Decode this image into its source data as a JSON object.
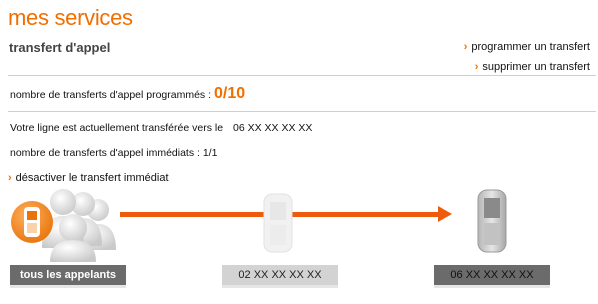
{
  "header": {
    "title": "mes services",
    "subtitle": "transfert d'appel"
  },
  "actions": {
    "schedule_label": "programmer un transfert",
    "delete_label": "supprimer un transfert"
  },
  "scheduled": {
    "label": "nombre de transferts d'appel programmés :",
    "count": "0/10"
  },
  "current": {
    "label": "Votre ligne est actuellement transférée vers le",
    "number": "06 XX XX XX XX",
    "immediate_label": "nombre de transferts d'appel immédiats : 1/1",
    "deactivate_label": "désactiver le transfert immédiat"
  },
  "diagram": {
    "source_label": "tous les appelants",
    "origin_number": "02  XX XX XX XX",
    "destination_number": "06 XX XX XX XX",
    "accent_color": "#ef5b0c"
  },
  "icons": {
    "chevron": "chevron-right-icon",
    "group": "user-group-icon",
    "phone": "mobile-phone-icon"
  }
}
